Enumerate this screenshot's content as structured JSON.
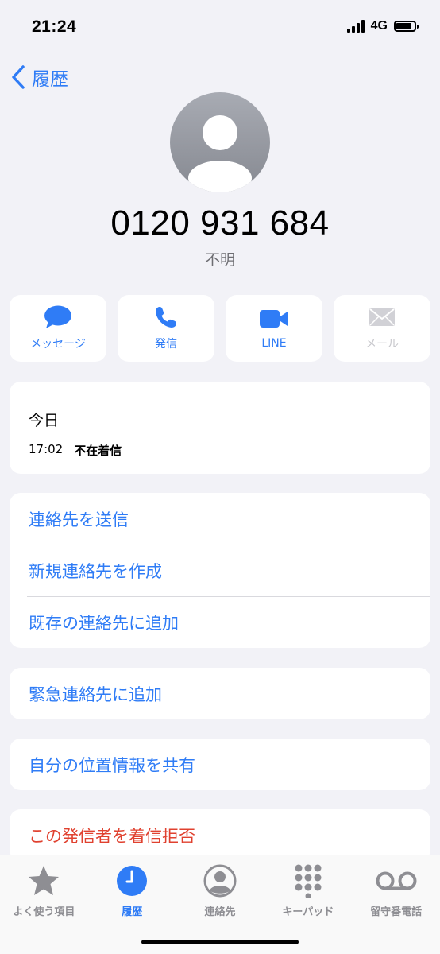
{
  "status": {
    "time": "21:24",
    "network": "4G"
  },
  "nav": {
    "back_label": "履歴"
  },
  "caller": {
    "number": "0120 931 684",
    "status": "不明"
  },
  "actions": [
    {
      "label": "メッセージ",
      "icon": "message-bubble-icon",
      "enabled": true
    },
    {
      "label": "発信",
      "icon": "phone-icon",
      "enabled": true
    },
    {
      "label": "LINE",
      "icon": "video-camera-icon",
      "enabled": true
    },
    {
      "label": "メール",
      "icon": "mail-icon",
      "enabled": false
    }
  ],
  "call_log": {
    "day": "今日",
    "time": "17:02",
    "type": "不在着信"
  },
  "contact_options": [
    "連絡先を送信",
    "新規連絡先を作成",
    "既存の連絡先に追加"
  ],
  "emergency": {
    "label": "緊急連絡先に追加"
  },
  "location": {
    "label": "自分の位置情報を共有"
  },
  "block": {
    "label": "この発信者を着信拒否"
  },
  "tabbar": {
    "items": [
      {
        "label": "よく使う項目",
        "icon": "star-icon"
      },
      {
        "label": "履歴",
        "icon": "clock-icon",
        "active": true
      },
      {
        "label": "連絡先",
        "icon": "person-circle-icon"
      },
      {
        "label": "キーパッド",
        "icon": "keypad-icon"
      },
      {
        "label": "留守番電話",
        "icon": "voicemail-icon"
      }
    ]
  },
  "colors": {
    "accent": "#2f7cf6",
    "danger": "#e0412f",
    "background": "#f2f2f7"
  }
}
